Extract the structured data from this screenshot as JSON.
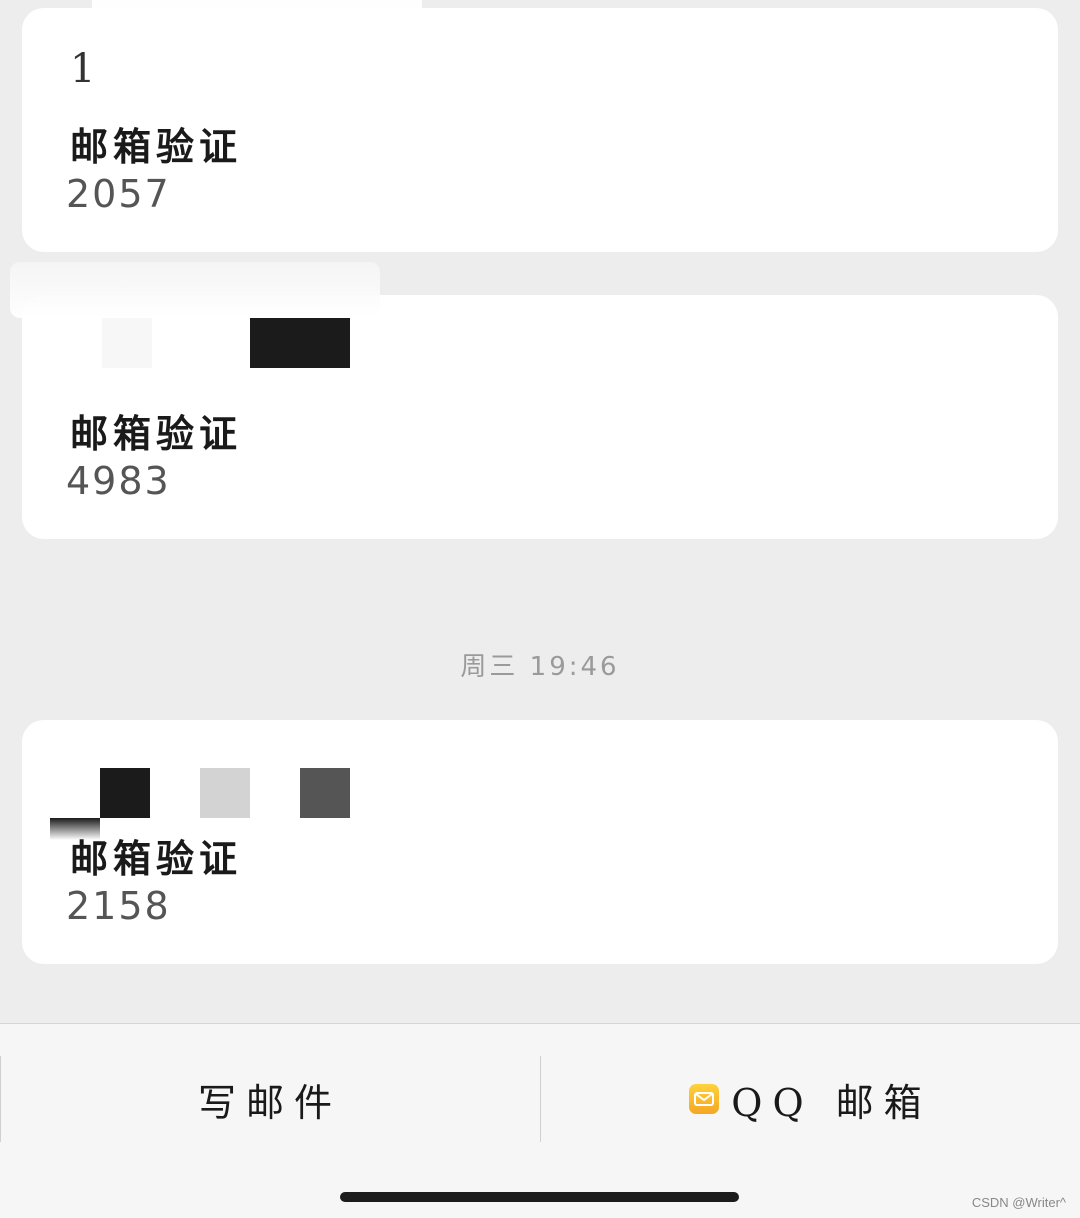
{
  "messages": [
    {
      "sender": "1",
      "subject": "邮箱验证",
      "code": "2057"
    },
    {
      "sender": "",
      "subject": "邮箱验证",
      "code": "4983"
    },
    {
      "sender": "",
      "subject": "邮箱验证",
      "code": "2158"
    }
  ],
  "time_label": "周三  19:46",
  "bottom_bar": {
    "compose_label": "写邮件",
    "qqmail_label": "QQ 邮箱"
  },
  "watermark": "CSDN @Writer^",
  "icons": {
    "mail": "qq-mail-icon"
  },
  "colors": {
    "background": "#ededed",
    "card": "#ffffff",
    "mail_icon": "#f5a623"
  }
}
